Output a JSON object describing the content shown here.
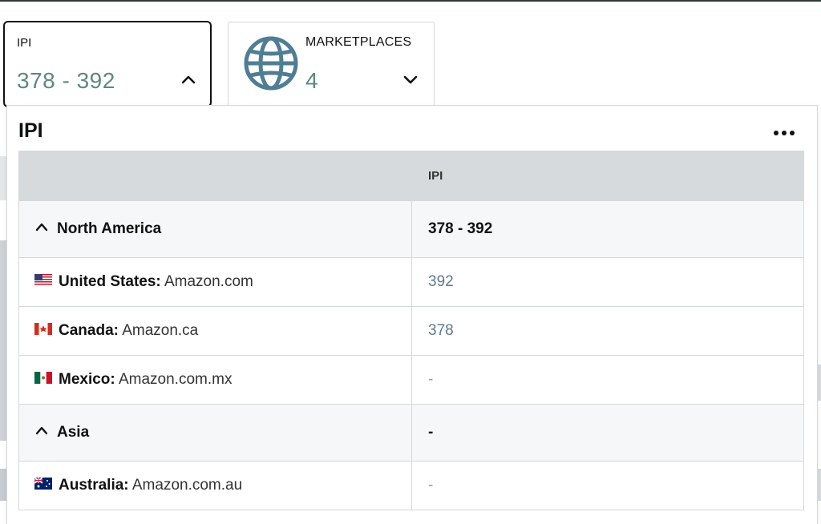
{
  "ipi_card": {
    "label": "IPI",
    "value": "378 - 392"
  },
  "marketplaces_card": {
    "label": "MARKETPLACES",
    "value": "4"
  },
  "popover": {
    "title": "IPI",
    "column_header": "IPI",
    "groups": [
      {
        "name": "North America",
        "value": "378 - 392",
        "rows": [
          {
            "country": "United States:",
            "domain": "Amazon.com",
            "value": "392",
            "flag": "us-flag-icon"
          },
          {
            "country": "Canada:",
            "domain": "Amazon.ca",
            "value": "378",
            "flag": "canada-flag-icon"
          },
          {
            "country": "Mexico:",
            "domain": "Amazon.com.mx",
            "value": "-",
            "flag": "mexico-flag-icon"
          }
        ]
      },
      {
        "name": "Asia",
        "value": "-",
        "rows": [
          {
            "country": "Australia:",
            "domain": "Amazon.com.au",
            "value": "-",
            "flag": "australia-flag-icon"
          }
        ]
      }
    ]
  },
  "colors": {
    "value_green": "#5a8a7a",
    "globe_blue": "#4f7e94",
    "link_blue": "#5f7a8c",
    "header_gray": "#d6dadc",
    "group_bg": "#f5f7f8"
  }
}
